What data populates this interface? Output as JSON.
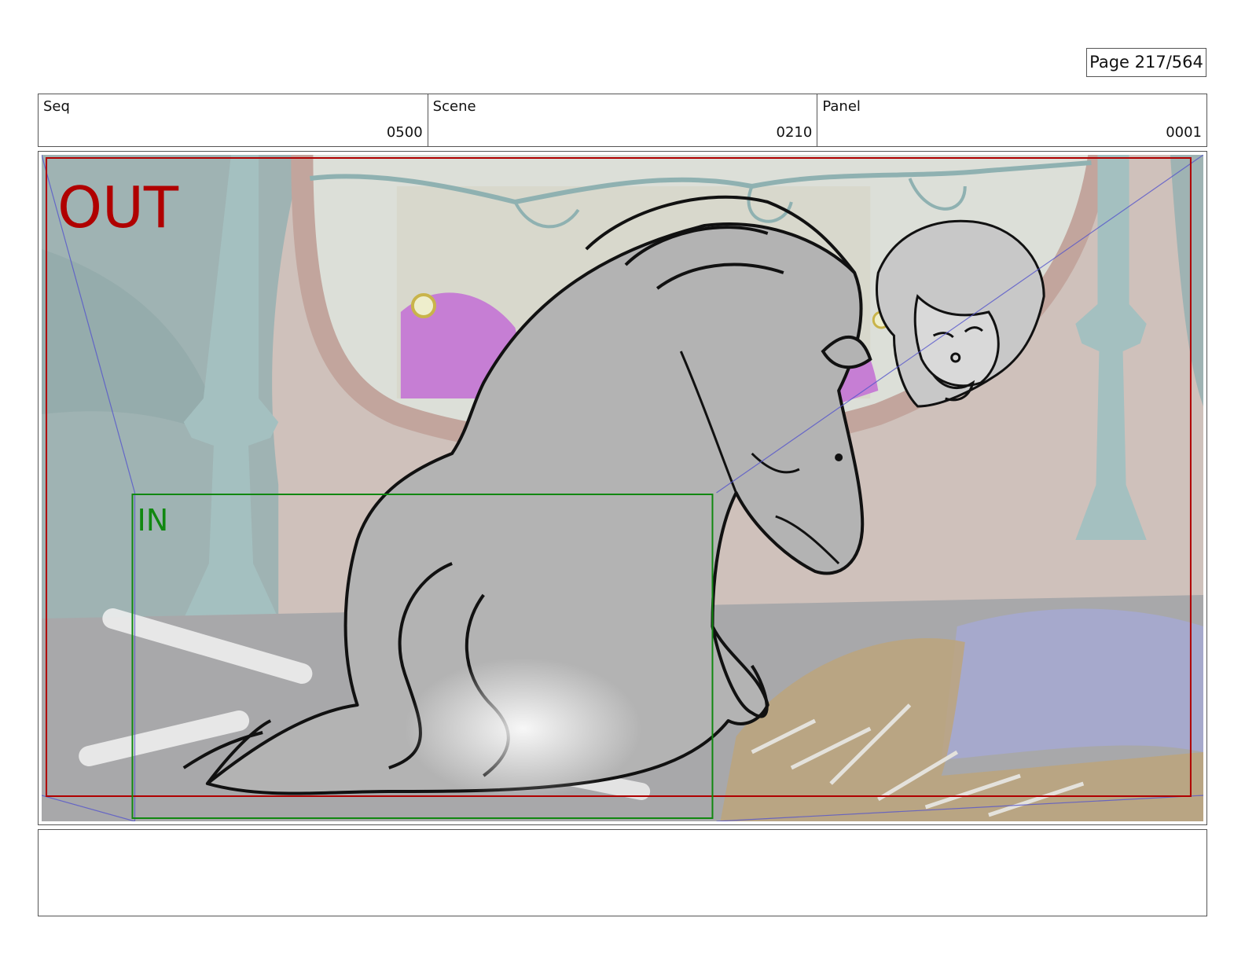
{
  "page": {
    "label": "Page 217/564"
  },
  "header": {
    "seq_label": "Seq",
    "seq_value": "0500",
    "scene_label": "Scene",
    "scene_value": "0210",
    "panel_label": "Panel",
    "panel_value": "0001"
  },
  "frames": {
    "out_label": "OUT",
    "in_label": "IN"
  },
  "colors": {
    "out_frame": "#b00000",
    "in_frame": "#118811",
    "camera_guide": "#5555cc",
    "wall": "#d2c2bc",
    "pillar": "#a9c4c4",
    "floor": "#a8a8a8",
    "window_magenta": "#c87ad6",
    "blanket": "#9da2c8",
    "straw": "#c4a576"
  },
  "notes": {
    "text": ""
  }
}
